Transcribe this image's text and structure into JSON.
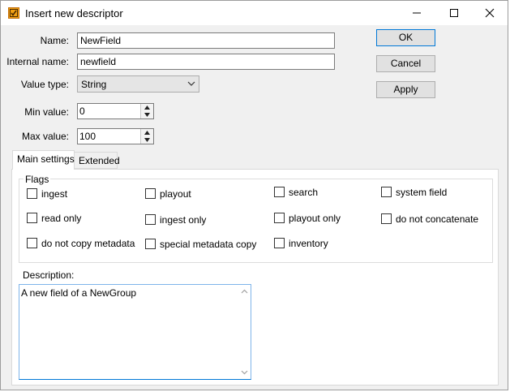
{
  "window": {
    "title": "Insert new descriptor"
  },
  "form": {
    "name_label": "Name:",
    "name_value": "NewField",
    "internal_name_label": "Internal name:",
    "internal_name_value": "newfield",
    "value_type_label": "Value type:",
    "value_type_value": "String",
    "min_value_label": "Min value:",
    "min_value": "0",
    "max_value_label": "Max value:",
    "max_value": "100"
  },
  "buttons": {
    "ok": "OK",
    "cancel": "Cancel",
    "apply": "Apply"
  },
  "tabs": [
    {
      "label": "Main settings",
      "active": true
    },
    {
      "label": "Extended",
      "active": false
    }
  ],
  "flags": {
    "title": "Flags",
    "items": [
      {
        "label": "ingest",
        "checked": false
      },
      {
        "label": "playout",
        "checked": false
      },
      {
        "label": "search",
        "checked": false
      },
      {
        "label": "system field",
        "checked": false
      },
      {
        "label": "read only",
        "checked": false
      },
      {
        "label": "ingest only",
        "checked": false
      },
      {
        "label": "playout only",
        "checked": false
      },
      {
        "label": "do not concatenate",
        "checked": false
      },
      {
        "label": "do not copy metadata",
        "checked": false
      },
      {
        "label": "special metadata copy",
        "checked": false
      },
      {
        "label": "inventory",
        "checked": false
      }
    ]
  },
  "description": {
    "label": "Description:",
    "value": "A new field of a NewGroup"
  },
  "colors": {
    "accent": "#0078d7",
    "app_icon": "#f2a013"
  }
}
